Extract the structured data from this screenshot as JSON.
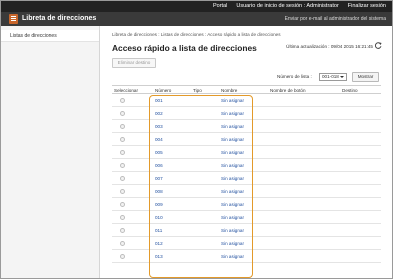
{
  "topbar": {
    "portal": "Portal",
    "user_label": "Usuario de inicio de sesión :",
    "user_name": "Administrator",
    "logout": "Finalizar sesión"
  },
  "header": {
    "title": "Libreta de direcciones",
    "admin_email": "Enviar por e-mail al administrador del sistema"
  },
  "sidebar": {
    "items": [
      {
        "label": "Listas de direcciones"
      }
    ]
  },
  "main": {
    "breadcrumb": "Libreta de direcciones : Listas de direcciones : Acceso rápido a lista de direcciones",
    "title": "Acceso rápido a lista de direcciones",
    "last_updated": "Última actualización : 09/04 2015 16:21:45",
    "delete_label": "Eliminar destino",
    "list_number_label": "Número de lista :",
    "list_number_value": "001-018",
    "show_label": "Mostrar",
    "columns": [
      "Seleccionar",
      "Número",
      "Tipo",
      "Nombre",
      "Nombre de botón",
      "Destino"
    ],
    "rows": [
      {
        "number": "001",
        "name": "Sin asignar"
      },
      {
        "number": "002",
        "name": "Sin asignar"
      },
      {
        "number": "003",
        "name": "Sin asignar"
      },
      {
        "number": "004",
        "name": "Sin asignar"
      },
      {
        "number": "005",
        "name": "Sin asignar"
      },
      {
        "number": "006",
        "name": "Sin asignar"
      },
      {
        "number": "007",
        "name": "Sin asignar"
      },
      {
        "number": "008",
        "name": "Sin asignar"
      },
      {
        "number": "009",
        "name": "Sin asignar"
      },
      {
        "number": "010",
        "name": "Sin asignar"
      },
      {
        "number": "011",
        "name": "Sin asignar"
      },
      {
        "number": "012",
        "name": "Sin asignar"
      },
      {
        "number": "013",
        "name": "Sin asignar"
      }
    ]
  },
  "colors": {
    "topbar": "#222222",
    "header": "#3a3a3a",
    "accent_icon": "#c7652a",
    "link": "#1f4e9e",
    "highlight": "#e39a2a"
  }
}
